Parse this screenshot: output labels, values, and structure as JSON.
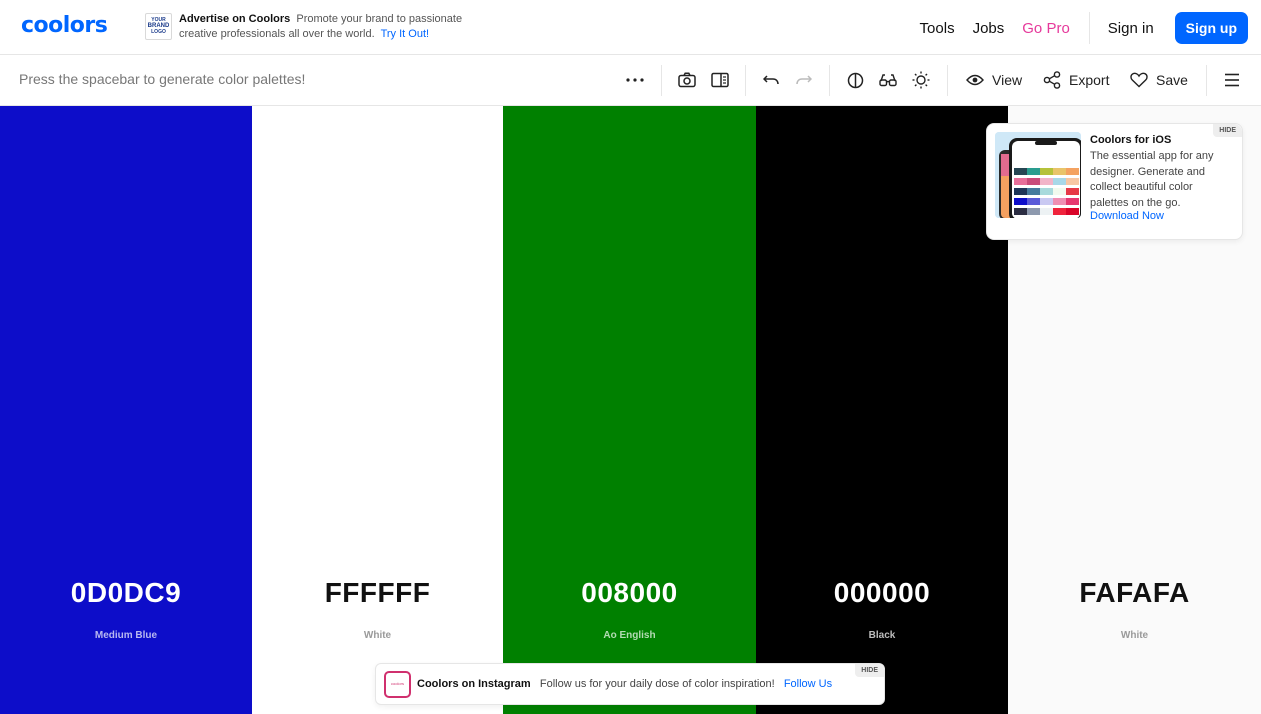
{
  "navbar": {
    "logo": "coolors",
    "ad": {
      "badge_lines": [
        "YOUR",
        "BRAND",
        "LOGO"
      ],
      "title": "Advertise on Coolors",
      "text": "Promote your brand to passionate creative professionals all over the world.",
      "link": "Try It Out!"
    },
    "links": {
      "tools": "Tools",
      "jobs": "Jobs",
      "gopro": "Go Pro"
    },
    "signin": "Sign in",
    "signup": "Sign up",
    "accent_color": "#0066ff",
    "pro_color": "#e6399b"
  },
  "toolbar": {
    "hint": "Press the spacebar to generate color palettes!",
    "icons": [
      "more-dots-icon",
      "camera-icon",
      "layout-panel-icon",
      "undo-icon",
      "redo-icon",
      "contrast-icon",
      "glasses-icon",
      "brightness-icon",
      "eye-icon",
      "share-icon",
      "heart-icon",
      "hamburger-menu-icon"
    ],
    "view_label": "View",
    "export_label": "Export",
    "save_label": "Save"
  },
  "palette": [
    {
      "hex": "0D0DC9",
      "name": "Medium Blue",
      "bg": "#0D0DC9",
      "text_color": "#ffffff",
      "name_color": "#b8b8f0"
    },
    {
      "hex": "FFFFFF",
      "name": "White",
      "bg": "#FFFFFF",
      "text_color": "#111111",
      "name_color": "#9a9a9a"
    },
    {
      "hex": "008000",
      "name": "Ao English",
      "bg": "#008000",
      "text_color": "#ffffff",
      "name_color": "#b3dbb3"
    },
    {
      "hex": "000000",
      "name": "Black",
      "bg": "#000000",
      "text_color": "#ffffff",
      "name_color": "#bdbdbd"
    },
    {
      "hex": "FAFAFA",
      "name": "White",
      "bg": "#FAFAFA",
      "text_color": "#111111",
      "name_color": "#9a9a9a"
    }
  ],
  "ios_card": {
    "title": "Coolors for iOS",
    "description": "The essential app for any designer. Generate and collect beautiful color palettes on the go.",
    "link": "Download Now",
    "hide": "HIDE"
  },
  "instagram": {
    "logo_text": "coolors",
    "title": "Coolors on Instagram",
    "text": "Follow us for your daily dose of color inspiration!",
    "link": "Follow Us",
    "hide": "HIDE"
  }
}
